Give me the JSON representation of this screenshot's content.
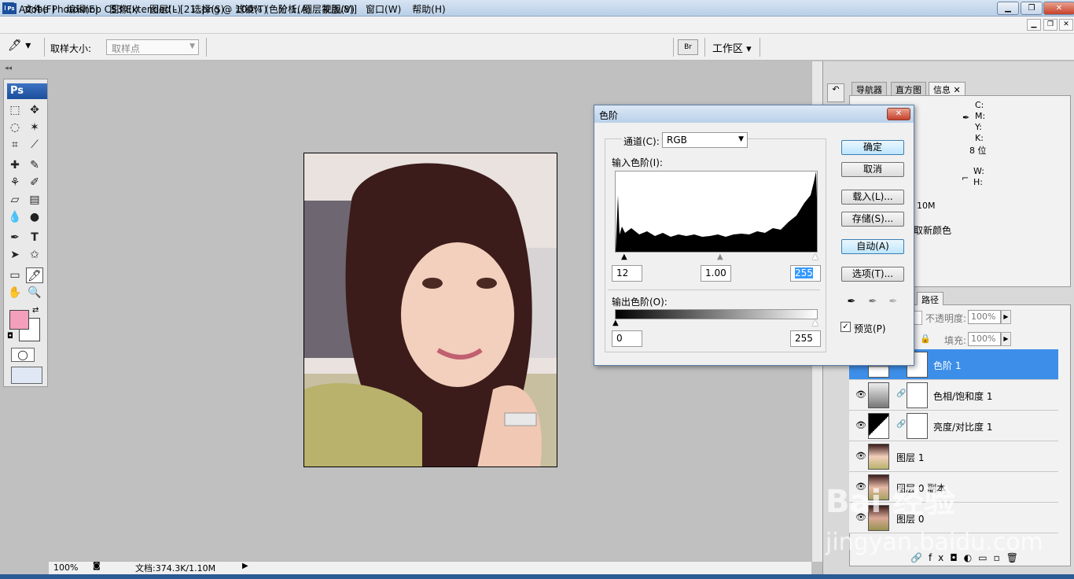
{
  "app": {
    "logo": "Ps",
    "title": "Adobe Photoshop CS3 Extended - [21..png @ 100% (色阶 1, 图层蒙版/8)]",
    "window_buttons": [
      "▁",
      "❐",
      "✕"
    ]
  },
  "menu": {
    "items": [
      "文件(F)",
      "编辑(E)",
      "图像(I)",
      "图层(L)",
      "选择(S)",
      "滤镜(T)",
      "分析(A)",
      "视图(V)",
      "窗口(W)",
      "帮助(H)"
    ]
  },
  "options_bar": {
    "sample_size_label": "取样大小:",
    "sample_size_value": "取样点",
    "workspace_label": "工作区 ▾",
    "bridge_icon": "bridge-icon"
  },
  "toolbox": {
    "logo": "Ps",
    "foreground_color": "#f49fbb",
    "background_color": "#ffffff"
  },
  "status": {
    "zoom": "100%",
    "doc": "文档:374.3K/1.10M"
  },
  "panels": {
    "tabs_top": [
      "导航器",
      "直方图",
      "信息"
    ],
    "info": {
      "c": "C:",
      "m": "M:",
      "y": "Y:",
      "k": "K:",
      "bits": "8 位",
      "w": "W:",
      "h": "H:",
      "doc_size": "10M",
      "hint": "取新颜色"
    },
    "layers_tab": "路径",
    "opacity_label": "不透明度:",
    "opacity_value": "100%",
    "fill_label": "填充:",
    "fill_value": "100%",
    "layers": [
      {
        "name": "色阶 1",
        "selected": true
      },
      {
        "name": "色相/饱和度 1",
        "selected": false
      },
      {
        "name": "亮度/对比度 1",
        "selected": false
      },
      {
        "name": "图层 1",
        "selected": false
      },
      {
        "name": "图层 0 副本",
        "selected": false
      },
      {
        "name": "图层 0",
        "selected": false
      }
    ]
  },
  "levels_dialog": {
    "title": "色阶",
    "channel_label": "通道(C):",
    "channel_value": "RGB",
    "input_label": "输入色阶(I):",
    "input_black": "12",
    "input_gamma": "1.00",
    "input_white": "255",
    "output_label": "输出色阶(O):",
    "output_black": "0",
    "output_white": "255",
    "buttons": {
      "ok": "确定",
      "cancel": "取消",
      "load": "载入(L)...",
      "save": "存储(S)...",
      "auto": "自动(A)",
      "options": "选项(T)..."
    },
    "preview_label": "预览(P)",
    "preview_checked": true
  },
  "watermark": {
    "text": "Bai 经验",
    "url": "jingyan.baidu.com"
  }
}
